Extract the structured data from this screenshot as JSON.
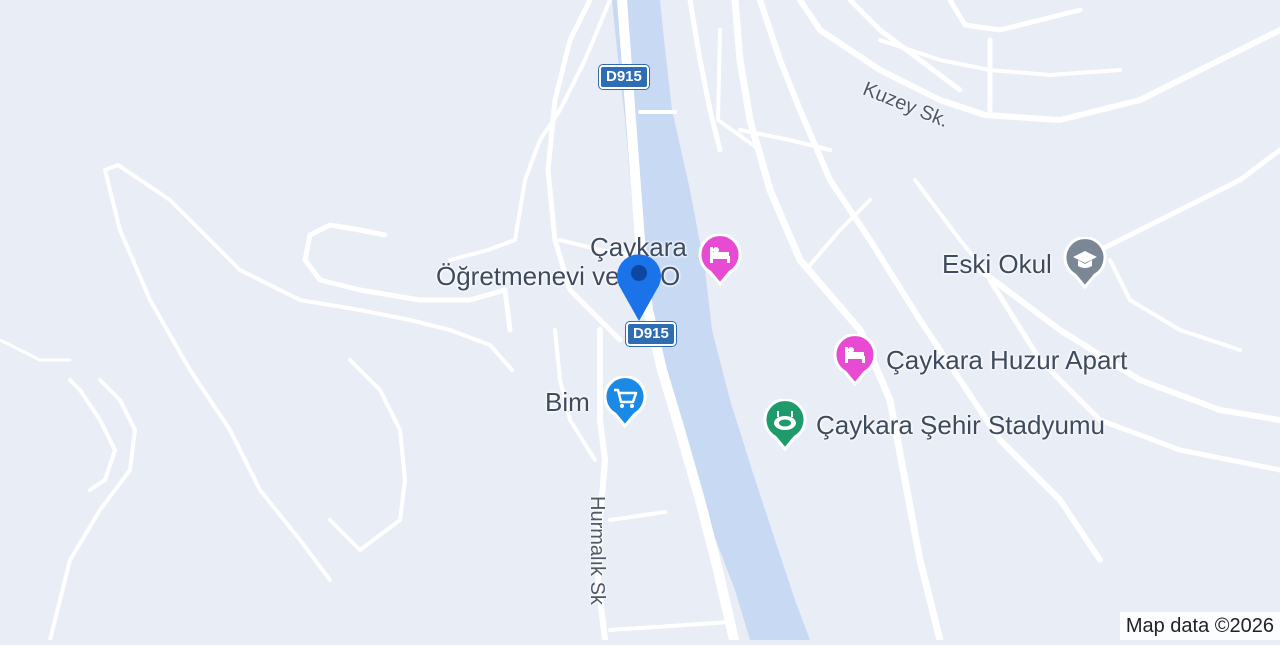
{
  "map": {
    "colors": {
      "land": "#e9edf5",
      "water": "#c7d9f3",
      "road": "#ffffff",
      "shield": "#2f6db3",
      "lodging": "#e84bd3",
      "stadium": "#1e9a6b",
      "shopping": "#1a8ae6",
      "school": "#7b8794",
      "marker": "#1a73e8"
    },
    "route_shields": [
      {
        "label": "D915"
      },
      {
        "label": "D915"
      }
    ],
    "pois": [
      {
        "line1": "Çaykara",
        "line2": "Öğretmenevi ve ASO",
        "icon": "bed-icon",
        "category": "lodging"
      },
      {
        "name": "Çaykara Huzur Apart",
        "icon": "bed-icon",
        "category": "lodging"
      },
      {
        "name": "Çaykara Şehir Stadyumu",
        "icon": "stadium-icon",
        "category": "stadium"
      },
      {
        "name": "Bim",
        "icon": "shopping-cart-icon",
        "category": "shopping"
      },
      {
        "name": "Eski Okul",
        "icon": "graduation-cap-icon",
        "category": "school"
      }
    ],
    "streets": [
      {
        "name": "Kuzey Sk."
      },
      {
        "name": "Hurmalık Sk"
      }
    ],
    "marker": {
      "icon": "location-pin-icon"
    },
    "attribution": "Map data ©2026"
  }
}
